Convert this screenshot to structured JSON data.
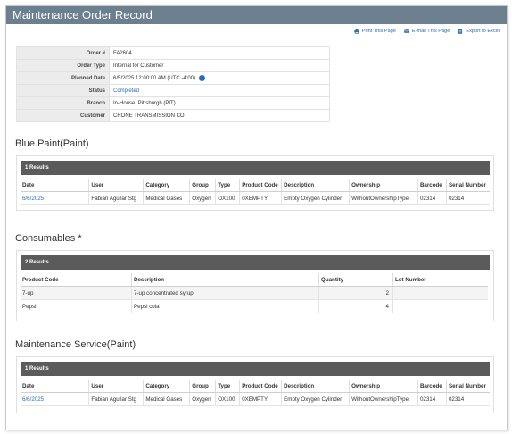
{
  "page_title": "Maintenance Order Record",
  "actions": {
    "print": "Print This Page",
    "email": "E-mail This Page",
    "export": "Export to Excel"
  },
  "order": {
    "labels": {
      "order_num": "Order #",
      "order_type": "Order Type",
      "planned_date": "Planned Date",
      "status": "Status",
      "branch": "Branch",
      "customer": "Customer"
    },
    "order_num": "FA2604",
    "order_type": "Internal for Customer",
    "planned_date": "6/5/2025 12:00:00 AM (UTC -4:00)",
    "status": "Completed",
    "branch": "In-House: Pittsburgh (PIT)",
    "customer": "CRONE TRANSMISSION CO"
  },
  "sections": {
    "blue_paint": {
      "title": "Blue.Paint(Paint)",
      "results": "1 Results",
      "headers": [
        "Date",
        "User",
        "Category",
        "Group",
        "Type",
        "Product Code",
        "Description",
        "Ownership",
        "Barcode",
        "Serial Number"
      ],
      "rows": [
        [
          "6/6/2025",
          "Fabian Aguilar Stg",
          "Medical Gases",
          "Oxygen",
          "OX100",
          "0XEMPTY",
          "Empty Oxygen Cylinder",
          "WithoutOwnershipType",
          "02314",
          "02314"
        ]
      ]
    },
    "consumables": {
      "title": "Consumables *",
      "results": "2 Results",
      "headers": [
        "Product Code",
        "Description",
        "Quantity",
        "Lot Number"
      ],
      "rows": [
        [
          "7-up",
          "7-up concentrated syrup",
          "2",
          ""
        ],
        [
          "Pepsi",
          "Pepsi cola",
          "4",
          ""
        ]
      ]
    },
    "maintenance_service": {
      "title": "Maintenance Service(Paint)",
      "results": "1 Results",
      "headers": [
        "Date",
        "User",
        "Category",
        "Group",
        "Type",
        "Product Code",
        "Description",
        "Ownership",
        "Barcode",
        "Serial Number"
      ],
      "rows": [
        [
          "6/6/2025",
          "Fabian Aguilar Stg",
          "Medical Gases",
          "Oxygen",
          "OX100",
          "0XEMPTY",
          "Empty Oxygen Cylinder",
          "WithoutOwnershipType",
          "02314",
          "02314"
        ]
      ]
    }
  },
  "colors": {
    "title_bar": "#6b7f8f",
    "link": "#2a6cb3",
    "results_bar": "#5b5b5b"
  },
  "icons": {
    "print": "printer-icon",
    "email": "envelope-icon",
    "export": "excel-file-icon",
    "timezone": "clock-icon"
  }
}
